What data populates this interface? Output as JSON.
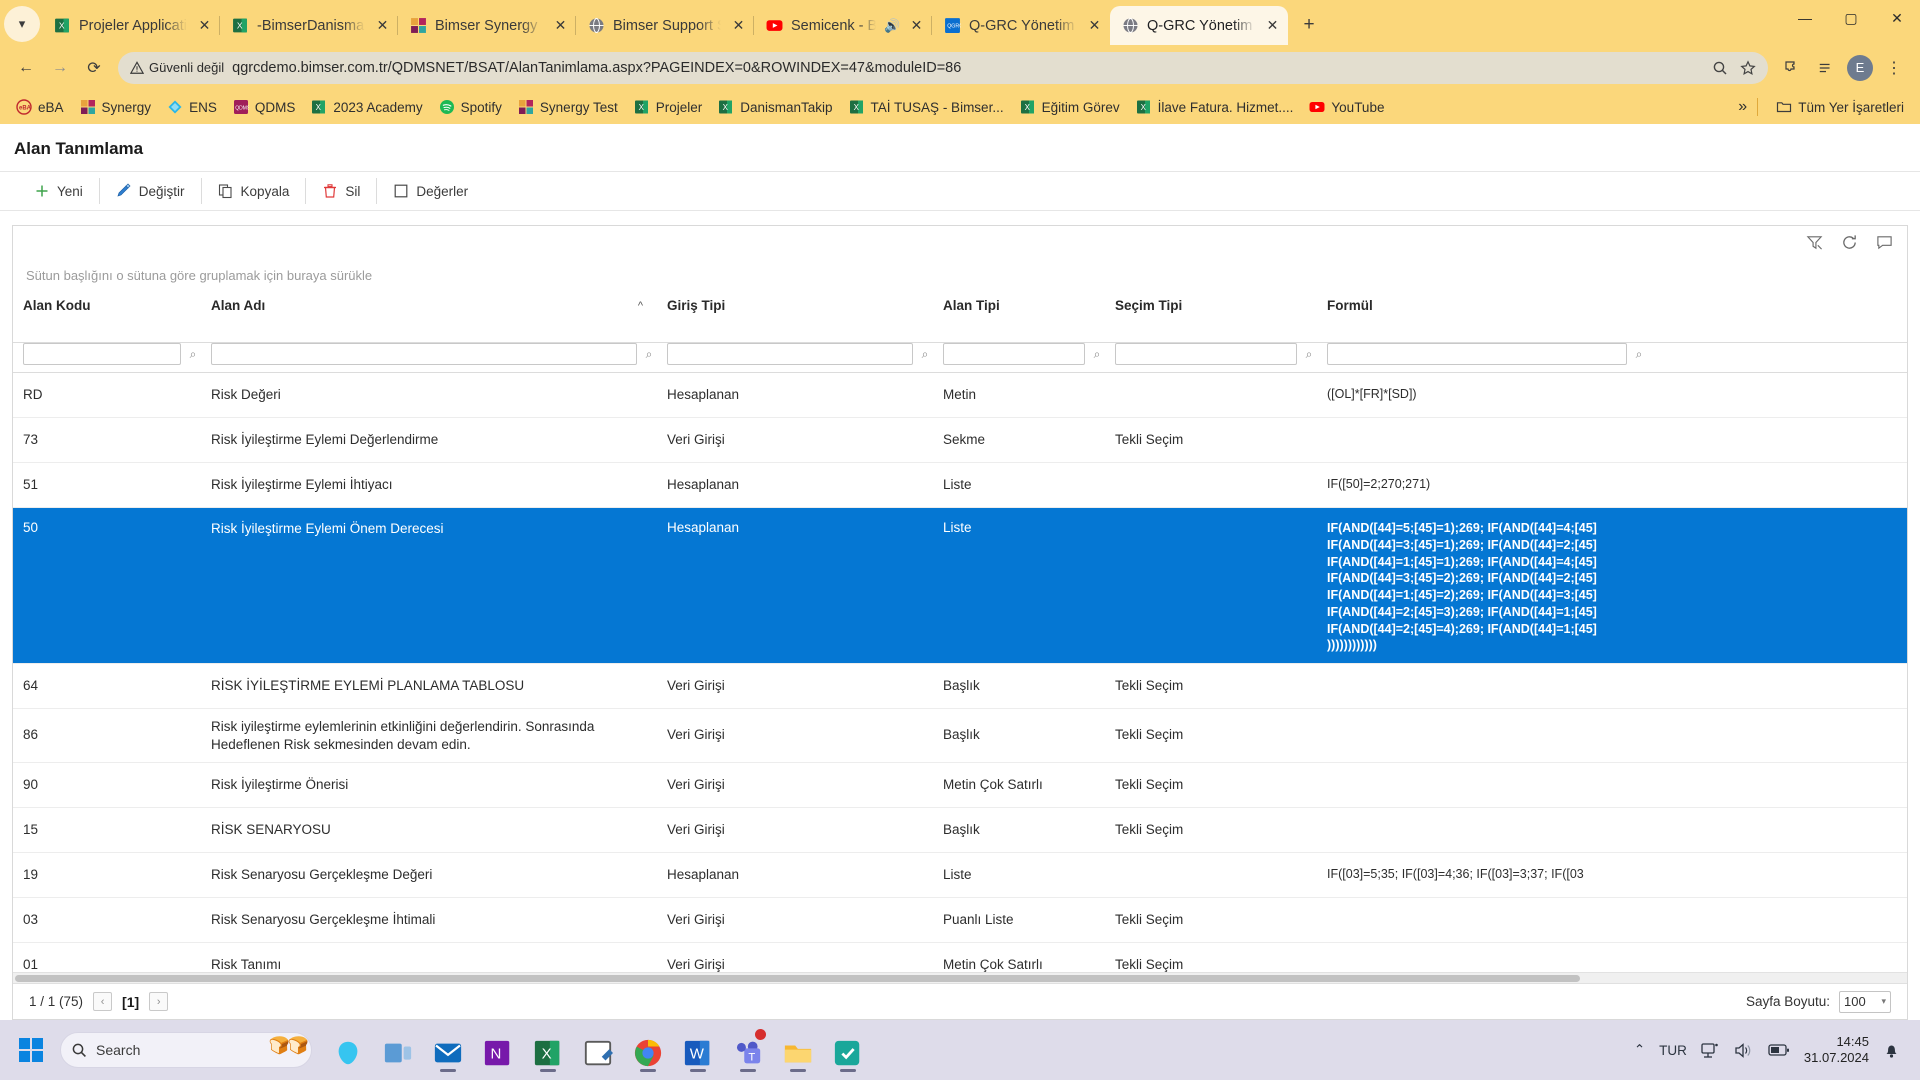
{
  "browser": {
    "tabs": [
      {
        "title": "Projeler Applications",
        "favicon": "excel-icon",
        "active": false,
        "audio": false
      },
      {
        "title": "-BimserDanismanTakip",
        "favicon": "excel-icon",
        "active": false,
        "audio": false
      },
      {
        "title": "Bimser Synergy",
        "favicon": "synergy-icon",
        "active": false,
        "audio": false
      },
      {
        "title": "Bimser Support System",
        "favicon": "globe-icon",
        "active": false,
        "audio": false
      },
      {
        "title": "Semicenk - Batık",
        "favicon": "youtube-icon",
        "active": false,
        "audio": true
      },
      {
        "title": "Q-GRC Yönetim Sistemi",
        "favicon": "qgrc-icon",
        "active": false,
        "audio": false
      },
      {
        "title": "Q-GRC Yönetim Sistemi",
        "favicon": "globe-icon",
        "active": true,
        "audio": false
      }
    ],
    "new_tab_label": "+",
    "window_controls": {
      "minimize": "—",
      "maximize": "▢",
      "close": "✕"
    },
    "nav": {
      "back": "←",
      "forward": "→",
      "reload": "⟳"
    },
    "omnibox": {
      "security_label": "Güvenli değil",
      "url": "qgrcdemo.bimser.com.tr/QDMSNET/BSAT/AlanTanimlama.aspx?PAGEINDEX=0&ROWINDEX=47&moduleID=86",
      "profile_initial": "E"
    },
    "bookmarks": [
      {
        "label": "eBA",
        "icon": "eba-icon"
      },
      {
        "label": "Synergy",
        "icon": "synergy-icon"
      },
      {
        "label": "ENS",
        "icon": "ens-icon"
      },
      {
        "label": "QDMS",
        "icon": "qdms-icon"
      },
      {
        "label": "2023 Academy",
        "icon": "excel-icon"
      },
      {
        "label": "Spotify",
        "icon": "spotify-icon"
      },
      {
        "label": "Synergy Test",
        "icon": "synergy-icon"
      },
      {
        "label": "Projeler",
        "icon": "excel-icon"
      },
      {
        "label": "DanismanTakip",
        "icon": "excel-icon"
      },
      {
        "label": "TAİ TUSAŞ - Bimser...",
        "icon": "excel-icon"
      },
      {
        "label": "Eğitim Görev",
        "icon": "excel-icon"
      },
      {
        "label": "İlave Fatura. Hizmet....",
        "icon": "excel-icon"
      },
      {
        "label": "YouTube",
        "icon": "youtube-icon"
      }
    ],
    "bookmarks_overflow": "»",
    "all_bookmarks_label": "Tüm Yer İşaretleri"
  },
  "app": {
    "page_title": "Alan Tanımlama",
    "commands": [
      {
        "label": "Yeni",
        "icon": "plus-icon"
      },
      {
        "label": "Değiştir",
        "icon": "pencil-icon"
      },
      {
        "label": "Kopyala",
        "icon": "copy-icon"
      },
      {
        "label": "Sil",
        "icon": "trash-icon"
      },
      {
        "label": "Değerler",
        "icon": "square-icon"
      }
    ],
    "grid": {
      "group_hint": "Sütun başlığını o sütuna göre gruplamak için buraya sürükle",
      "toolbar_icons": [
        "clear-filter-icon",
        "refresh-icon",
        "comment-icon"
      ],
      "columns": [
        {
          "key": "alan_kodu",
          "label": "Alan Kodu",
          "filter": true,
          "sorted": false
        },
        {
          "key": "alan_adi",
          "label": "Alan Adı",
          "filter": true,
          "sorted": true,
          "sort_arrow": "^"
        },
        {
          "key": "giris_tipi",
          "label": "Giriş Tipi",
          "filter": true,
          "sorted": false
        },
        {
          "key": "alan_tipi",
          "label": "Alan Tipi",
          "filter": true,
          "sorted": false
        },
        {
          "key": "secim_tipi",
          "label": "Seçim Tipi",
          "filter": true,
          "sorted": false
        },
        {
          "key": "formul",
          "label": "Formül",
          "filter": true,
          "sorted": false
        }
      ],
      "rows": [
        {
          "alan_kodu": "RD",
          "alan_adi": "Risk Değeri",
          "giris_tipi": "Hesaplanan",
          "alan_tipi": "Metin",
          "secim_tipi": "",
          "formul": "([OL]*[FR]*[SD])",
          "selected": false
        },
        {
          "alan_kodu": "73",
          "alan_adi": "Risk İyileştirme Eylemi Değerlendirme",
          "giris_tipi": "Veri Girişi",
          "alan_tipi": "Sekme",
          "secim_tipi": "Tekli Seçim",
          "formul": "",
          "selected": false
        },
        {
          "alan_kodu": "51",
          "alan_adi": "Risk İyileştirme Eylemi İhtiyacı",
          "giris_tipi": "Hesaplanan",
          "alan_tipi": "Liste",
          "secim_tipi": "",
          "formul": "IF([50]=2;270;271)",
          "selected": false
        },
        {
          "alan_kodu": "50",
          "alan_adi": "Risk İyileştirme Eylemi Önem Derecesi",
          "giris_tipi": "Hesaplanan",
          "alan_tipi": "Liste",
          "secim_tipi": "",
          "formul": "IF(AND([44]=5;[45]=1);269; IF(AND([44]=4;[45]\nIF(AND([44]=3;[45]=1);269; IF(AND([44]=2;[45]\nIF(AND([44]=1;[45]=1);269; IF(AND([44]=4;[45]\nIF(AND([44]=3;[45]=2);269; IF(AND([44]=2;[45]\nIF(AND([44]=1;[45]=2);269; IF(AND([44]=3;[45]\nIF(AND([44]=2;[45]=3);269; IF(AND([44]=1;[45]\nIF(AND([44]=2;[45]=4);269; IF(AND([44]=1;[45]\n))))))))))))",
          "selected": true
        },
        {
          "alan_kodu": "64",
          "alan_adi": "RİSK İYİLEŞTİRME EYLEMİ PLANLAMA TABLOSU",
          "giris_tipi": "Veri Girişi",
          "alan_tipi": "Başlık",
          "secim_tipi": "Tekli Seçim",
          "formul": "",
          "selected": false
        },
        {
          "alan_kodu": "86",
          "alan_adi": "Risk iyileştirme eylemlerinin etkinliğini değerlendirin. Sonrasında Hedeflenen Risk sekmesinden devam edin.",
          "giris_tipi": "Veri Girişi",
          "alan_tipi": "Başlık",
          "secim_tipi": "Tekli Seçim",
          "formul": "",
          "selected": false
        },
        {
          "alan_kodu": "90",
          "alan_adi": "Risk İyileştirme Önerisi",
          "giris_tipi": "Veri Girişi",
          "alan_tipi": "Metin Çok Satırlı",
          "secim_tipi": "Tekli Seçim",
          "formul": "",
          "selected": false
        },
        {
          "alan_kodu": "15",
          "alan_adi": "RİSK SENARYOSU",
          "giris_tipi": "Veri Girişi",
          "alan_tipi": "Başlık",
          "secim_tipi": "Tekli Seçim",
          "formul": "",
          "selected": false
        },
        {
          "alan_kodu": "19",
          "alan_adi": "Risk Senaryosu Gerçekleşme Değeri",
          "giris_tipi": "Hesaplanan",
          "alan_tipi": "Liste",
          "secim_tipi": "",
          "formul": "IF([03]=5;35; IF([03]=4;36; IF([03]=3;37; IF([03",
          "selected": false
        },
        {
          "alan_kodu": "03",
          "alan_adi": "Risk Senaryosu Gerçekleşme İhtimali",
          "giris_tipi": "Veri Girişi",
          "alan_tipi": "Puanlı Liste",
          "secim_tipi": "Tekli Seçim",
          "formul": "",
          "selected": false
        },
        {
          "alan_kodu": "01",
          "alan_adi": "Risk Tanımı",
          "giris_tipi": "Veri Girişi",
          "alan_tipi": "Metin Çok Satırlı",
          "secim_tipi": "Tekli Seçim",
          "formul": "",
          "selected": false
        }
      ]
    },
    "pager": {
      "summary": "1 / 1 (75)",
      "prev": "‹",
      "current": "[1]",
      "next": "›",
      "page_size_label": "Sayfa Boyutu:",
      "page_size_value": "100"
    }
  },
  "taskbar": {
    "start_icon": "windows-icon",
    "search_placeholder": "Search",
    "apps": [
      {
        "name": "copilot-icon",
        "running": false,
        "badge": false
      },
      {
        "name": "task-view-icon",
        "running": false,
        "badge": false
      },
      {
        "name": "outlook-icon",
        "running": true,
        "badge": false
      },
      {
        "name": "onenote-icon",
        "running": false,
        "badge": false
      },
      {
        "name": "excel-icon",
        "running": true,
        "badge": false
      },
      {
        "name": "notepad-icon",
        "running": false,
        "badge": false
      },
      {
        "name": "chrome-icon",
        "running": true,
        "badge": false
      },
      {
        "name": "word-icon",
        "running": true,
        "badge": false
      },
      {
        "name": "teams-icon",
        "running": true,
        "badge": true
      },
      {
        "name": "file-explorer-icon",
        "running": true,
        "badge": false
      },
      {
        "name": "qdms-app-icon",
        "running": true,
        "badge": false
      }
    ],
    "tray": {
      "chevron": "⌃",
      "language": "TUR",
      "network_icon": "network-icon",
      "volume_icon": "volume-icon",
      "battery_icon": "battery-icon",
      "time": "14:45",
      "date": "31.07.2024",
      "notification_icon": "bell-icon"
    }
  }
}
